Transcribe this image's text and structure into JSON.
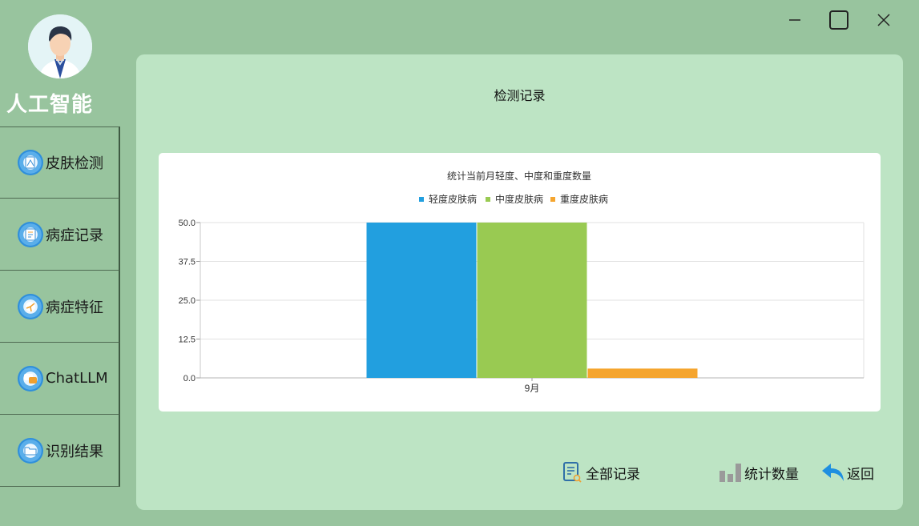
{
  "app": {
    "title": "人工智能"
  },
  "sidebar": {
    "items": [
      {
        "label": "皮肤检测",
        "icon": "skin-scan-icon"
      },
      {
        "label": "病症记录",
        "icon": "record-list-icon"
      },
      {
        "label": "病症特征",
        "icon": "feature-icon"
      },
      {
        "label": "ChatLLM",
        "icon": "chat-icon"
      },
      {
        "label": "识别结果",
        "icon": "folder-icon"
      }
    ]
  },
  "window_controls": {
    "minimize": "minimize-icon",
    "maximize": "maximize-icon",
    "close": "close-icon"
  },
  "main": {
    "title": "检测记录",
    "actions": [
      {
        "label": "全部记录",
        "icon": "document-search-icon"
      },
      {
        "label": "统计数量",
        "icon": "bar-stats-icon"
      },
      {
        "label": "返回",
        "icon": "back-arrow-icon"
      }
    ]
  },
  "colors": {
    "mild": "#229fdf",
    "moderate": "#99ca52",
    "severe": "#f5a52f"
  },
  "chart_data": {
    "type": "bar",
    "title": "统计当前月轻度、中度和重度数量",
    "categories": [
      "9月"
    ],
    "series": [
      {
        "name": "轻度皮肤病",
        "values": [
          50
        ]
      },
      {
        "name": "中度皮肤病",
        "values": [
          50
        ]
      },
      {
        "name": "重度皮肤病",
        "values": [
          3
        ]
      }
    ],
    "yticks": [
      "0.0",
      "12.5",
      "25.0",
      "37.5",
      "50.0"
    ],
    "ylim": [
      0,
      50
    ],
    "grid": true,
    "legend_position": "top-center",
    "xlabel": "",
    "ylabel": ""
  }
}
